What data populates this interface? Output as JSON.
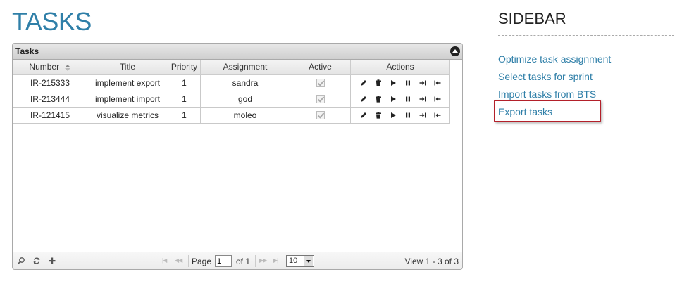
{
  "page": {
    "title": "TASKS"
  },
  "grid": {
    "caption": "Tasks",
    "columns": [
      "Number",
      "Title",
      "Priority",
      "Assignment",
      "Active",
      "Actions"
    ],
    "rows": [
      {
        "number": "IR-215333",
        "title": "implement export",
        "priority": "1",
        "assignment": "sandra",
        "active": true
      },
      {
        "number": "IR-213444",
        "title": "implement import",
        "priority": "1",
        "assignment": "god",
        "active": true
      },
      {
        "number": "IR-121415",
        "title": "visualize metrics",
        "priority": "1",
        "assignment": "moleo",
        "active": true
      }
    ],
    "action_icons": [
      "edit-icon",
      "delete-icon",
      "play-icon",
      "pause-icon",
      "skip-icon",
      "back-icon"
    ]
  },
  "pager": {
    "page_label": "Page",
    "page_value": "1",
    "of_label": "of 1",
    "rows_per_page": "10",
    "view_text": "View 1 - 3 of 3",
    "icons": [
      "search-icon",
      "refresh-icon",
      "add-icon"
    ]
  },
  "sidebar": {
    "title": "SIDEBAR",
    "links": [
      "Optimize task assignment",
      "Select tasks for sprint",
      "Import tasks from BTS",
      "Export tasks"
    ]
  },
  "colors": {
    "accent": "#2f7fa8",
    "highlight": "#b3202a"
  }
}
